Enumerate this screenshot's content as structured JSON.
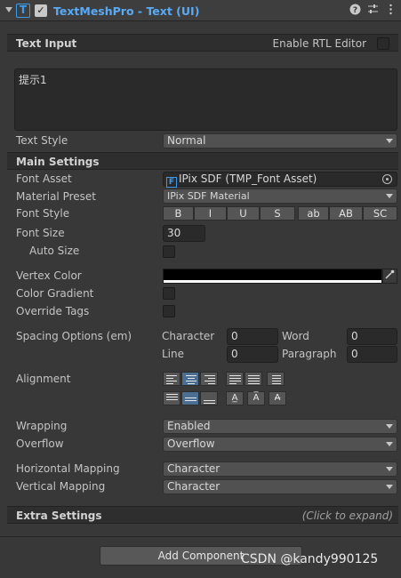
{
  "header": {
    "title": "TextMeshPro - Text (UI)",
    "component_icon": "T",
    "enabled_check": "✓",
    "icons": [
      "help-icon",
      "presets-icon",
      "kebab-menu-icon"
    ]
  },
  "text_input": {
    "section_label": "Text Input",
    "rtl_label": "Enable RTL Editor",
    "value": "提示1"
  },
  "text_style": {
    "label": "Text Style",
    "value": "Normal"
  },
  "main_settings": {
    "section_label": "Main Settings",
    "font_asset": {
      "label": "Font Asset",
      "icon": "F",
      "value": "IPix SDF (TMP_Font Asset)"
    },
    "material_preset": {
      "label": "Material Preset",
      "value": "IPix SDF Material"
    },
    "font_style": {
      "label": "Font Style",
      "buttons": [
        "B",
        "I",
        "U",
        "S",
        "ab",
        "AB",
        "SC"
      ]
    },
    "font_size": {
      "label": "Font Size",
      "value": "30"
    },
    "auto_size": {
      "label": "Auto Size"
    },
    "vertex_color": {
      "label": "Vertex Color",
      "value": "#000000"
    },
    "color_gradient": {
      "label": "Color Gradient"
    },
    "override_tags": {
      "label": "Override Tags"
    },
    "spacing": {
      "label": "Spacing Options (em)",
      "character_label": "Character",
      "character": "0",
      "word_label": "Word",
      "word": "0",
      "line_label": "Line",
      "line": "0",
      "paragraph_label": "Paragraph",
      "paragraph": "0"
    },
    "alignment": {
      "label": "Alignment"
    },
    "wrapping": {
      "label": "Wrapping",
      "value": "Enabled"
    },
    "overflow": {
      "label": "Overflow",
      "value": "Overflow"
    },
    "horizontal_mapping": {
      "label": "Horizontal Mapping",
      "value": "Character"
    },
    "vertical_mapping": {
      "label": "Vertical Mapping",
      "value": "Character"
    }
  },
  "extra_settings": {
    "section_label": "Extra Settings",
    "hint": "(Click to expand)"
  },
  "add_component": {
    "label": "Add Component"
  },
  "watermark": "CSDN @kandy990125",
  "colors": {
    "accent": "#3d9be9",
    "background": "#383838",
    "selected_button": "#4b6f92"
  }
}
